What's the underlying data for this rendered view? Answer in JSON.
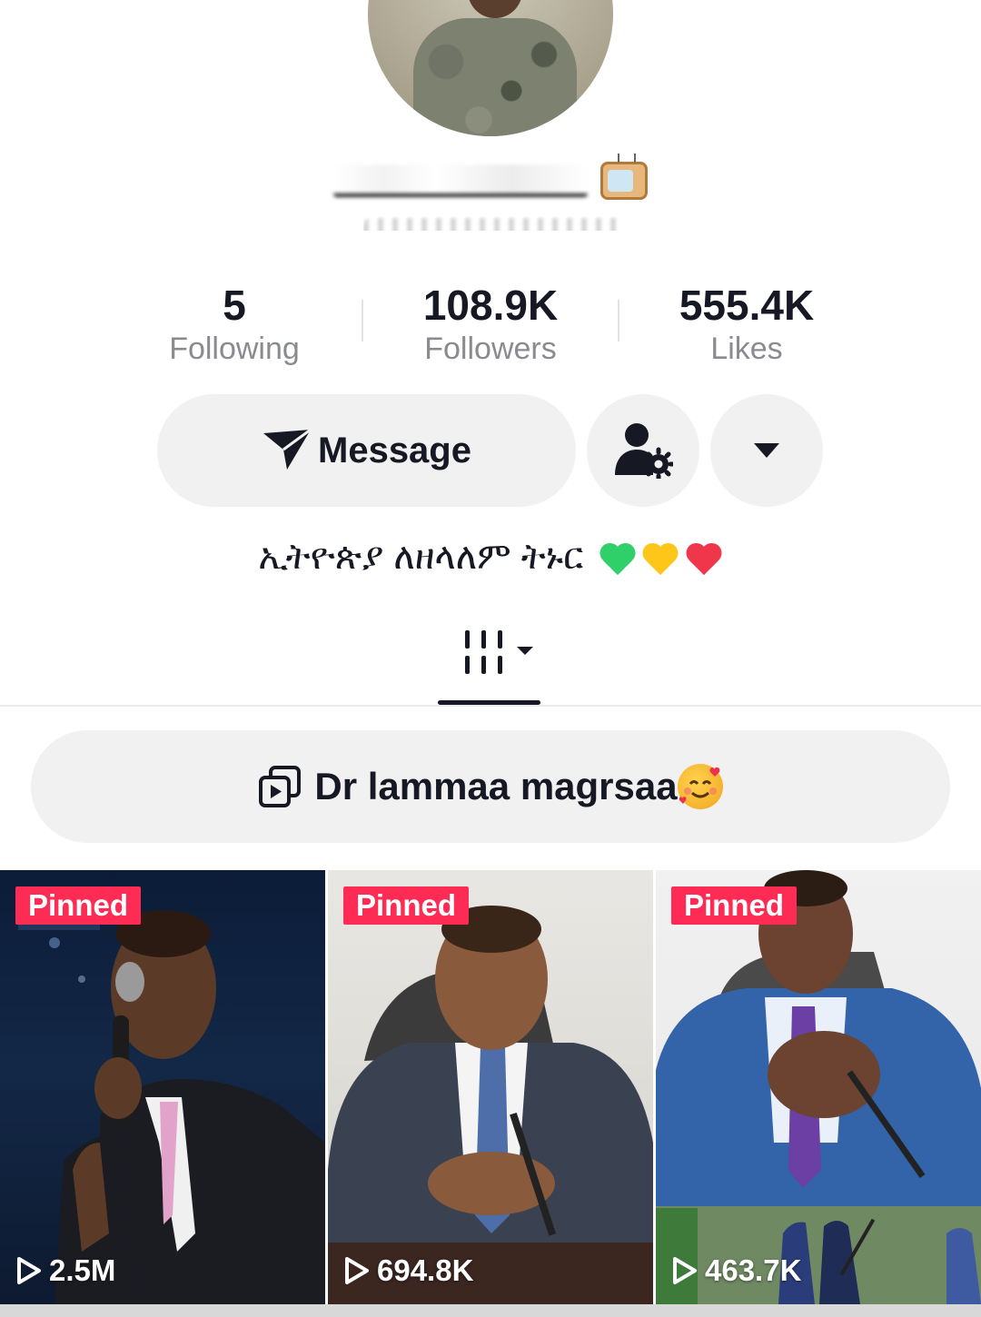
{
  "profile": {
    "stats": [
      {
        "value": "5",
        "label": "Following"
      },
      {
        "value": "108.9K",
        "label": "Followers"
      },
      {
        "value": "555.4K",
        "label": "Likes"
      }
    ],
    "display_name_icon": "tv-icon",
    "bio": "ኢትዮጵያ ለዘላለም ትኑር"
  },
  "actions": {
    "message_label": "Message",
    "add_friend_icon": "person-gear-icon",
    "more_icon": "caret-down-icon"
  },
  "tabs": {
    "active": "videos-grid",
    "icon": "grid-bars-icon"
  },
  "playlist": {
    "title": "Dr lammaa magrsaa"
  },
  "videos": [
    {
      "badge": "Pinned",
      "views": "2.5M"
    },
    {
      "badge": "Pinned",
      "views": "694.8K"
    },
    {
      "badge": "Pinned",
      "views": "463.7K"
    }
  ],
  "colors": {
    "pinned_badge": "#fe2c55",
    "button_bg": "#f1f1f2",
    "text_primary": "#161823",
    "text_secondary": "#8a8b91"
  }
}
